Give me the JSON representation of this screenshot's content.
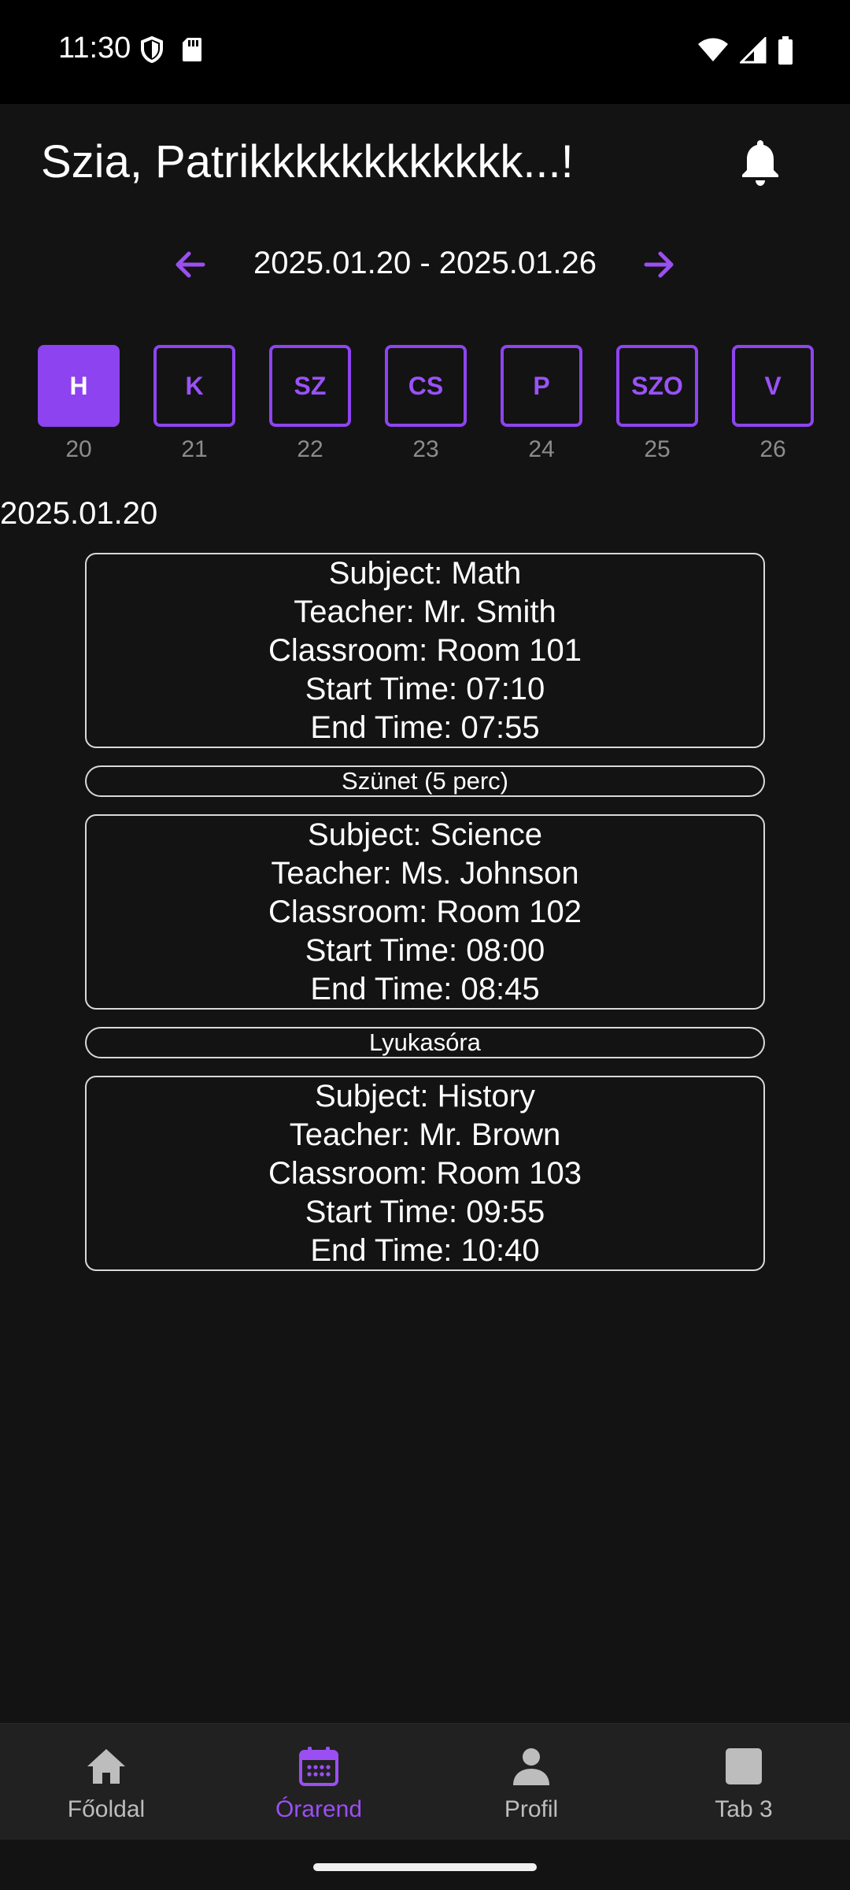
{
  "status_bar": {
    "time": "11:30",
    "icons": [
      "shield-icon",
      "sd-card-icon",
      "wifi-icon",
      "signal-icon",
      "battery-icon"
    ]
  },
  "header": {
    "greeting": "Szia, Patrikkkkkkkkkkkk...!",
    "bell_icon": "bell-icon"
  },
  "week": {
    "range": "2025.01.20 - 2025.01.26",
    "prev_icon": "arrow-left-icon",
    "next_icon": "arrow-right-icon"
  },
  "days": [
    {
      "label": "H",
      "num": "20",
      "active": true
    },
    {
      "label": "K",
      "num": "21",
      "active": false
    },
    {
      "label": "SZ",
      "num": "22",
      "active": false
    },
    {
      "label": "CS",
      "num": "23",
      "active": false
    },
    {
      "label": "P",
      "num": "24",
      "active": false
    },
    {
      "label": "SZO",
      "num": "25",
      "active": false
    },
    {
      "label": "V",
      "num": "26",
      "active": false
    }
  ],
  "selected_date": "2025.01.20",
  "schedule": {
    "lessons": [
      {
        "subject": "Subject: Math",
        "teacher": "Teacher: Mr. Smith",
        "classroom": "Classroom: Room 101",
        "start": "Start Time: 07:10",
        "end": "End Time: 07:55"
      },
      {
        "subject": "Subject: Science",
        "teacher": "Teacher: Ms. Johnson",
        "classroom": "Classroom: Room 102",
        "start": "Start Time: 08:00",
        "end": "End Time: 08:45"
      },
      {
        "subject": "Subject: History",
        "teacher": "Teacher: Mr. Brown",
        "classroom": "Classroom: Room 103",
        "start": "Start Time: 09:55",
        "end": "End Time: 10:40"
      }
    ],
    "gaps": [
      "Szünet (5 perc)",
      "Lyukasóra"
    ]
  },
  "bottom_nav": {
    "tabs": [
      {
        "label": "Főoldal",
        "icon": "home-icon",
        "active": false
      },
      {
        "label": "Órarend",
        "icon": "calendar-icon",
        "active": true
      },
      {
        "label": "Profil",
        "icon": "person-icon",
        "active": false
      },
      {
        "label": "Tab 3",
        "icon": "square-icon",
        "active": false
      }
    ]
  },
  "colors": {
    "accent": "#8d43ef",
    "background": "#131313",
    "nav_background": "#212121"
  }
}
